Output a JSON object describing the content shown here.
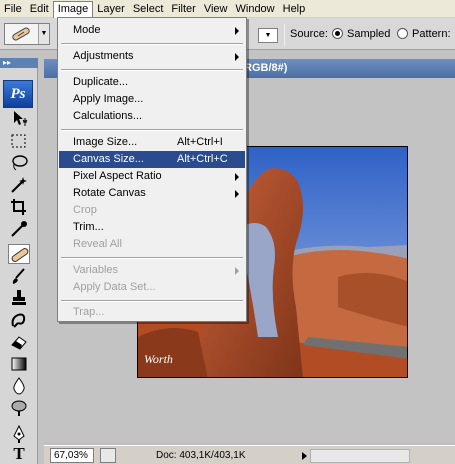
{
  "menubar": {
    "items": [
      {
        "label": "File"
      },
      {
        "label": "Edit"
      },
      {
        "label": "Image"
      },
      {
        "label": "Layer"
      },
      {
        "label": "Select"
      },
      {
        "label": "Filter"
      },
      {
        "label": "View"
      },
      {
        "label": "Window"
      },
      {
        "label": "Help"
      }
    ],
    "active": "Image"
  },
  "options": {
    "source_label": "Source:",
    "sampled_label": "Sampled",
    "pattern_label": "Pattern:",
    "selected_source": "Sampled"
  },
  "toolbox": {
    "logo": "Ps",
    "tools": [
      {
        "icon": "move-tool-icon"
      },
      {
        "icon": "marquee-tool-icon"
      },
      {
        "icon": "lasso-tool-icon"
      },
      {
        "icon": "magic-wand-tool-icon"
      },
      {
        "icon": "crop-tool-icon"
      },
      {
        "icon": "eyedropper-tool-icon"
      },
      {
        "icon": "healing-brush-tool-icon"
      },
      {
        "icon": "brush-tool-icon"
      },
      {
        "icon": "clone-stamp-tool-icon"
      },
      {
        "icon": "history-brush-tool-icon"
      },
      {
        "icon": "eraser-tool-icon"
      },
      {
        "icon": "gradient-tool-icon"
      },
      {
        "icon": "blur-tool-icon"
      },
      {
        "icon": "dodge-tool-icon"
      },
      {
        "icon": "pen-tool-icon"
      },
      {
        "icon": "type-tool-icon"
      }
    ],
    "type_glyph": "T"
  },
  "document": {
    "title_fragment": "RGB/8#)",
    "zoom": "67,03%",
    "doc_info": "Doc: 403,1K/403,1K"
  },
  "image_menu": {
    "items": [
      {
        "label": "Mode",
        "shortcut": "",
        "submenu": true,
        "enabled": true
      },
      {
        "label": "Adjustments",
        "shortcut": "",
        "submenu": true,
        "enabled": true
      },
      {
        "label": "Duplicate...",
        "shortcut": "",
        "submenu": false,
        "enabled": true
      },
      {
        "label": "Apply Image...",
        "shortcut": "",
        "submenu": false,
        "enabled": true
      },
      {
        "label": "Calculations...",
        "shortcut": "",
        "submenu": false,
        "enabled": true
      },
      {
        "label": "Image Size...",
        "shortcut": "Alt+Ctrl+I",
        "submenu": false,
        "enabled": true
      },
      {
        "label": "Canvas Size...",
        "shortcut": "Alt+Ctrl+C",
        "submenu": false,
        "enabled": true,
        "highlighted": true
      },
      {
        "label": "Pixel Aspect Ratio",
        "shortcut": "",
        "submenu": true,
        "enabled": true
      },
      {
        "label": "Rotate Canvas",
        "shortcut": "",
        "submenu": true,
        "enabled": true
      },
      {
        "label": "Crop",
        "shortcut": "",
        "submenu": false,
        "enabled": false
      },
      {
        "label": "Trim...",
        "shortcut": "",
        "submenu": false,
        "enabled": true
      },
      {
        "label": "Reveal All",
        "shortcut": "",
        "submenu": false,
        "enabled": false
      },
      {
        "label": "Variables",
        "shortcut": "",
        "submenu": true,
        "enabled": false
      },
      {
        "label": "Apply Data Set...",
        "shortcut": "",
        "submenu": false,
        "enabled": false
      },
      {
        "label": "Trap...",
        "shortcut": "",
        "submenu": false,
        "enabled": false
      }
    ]
  },
  "photo": {
    "signature": "Worth"
  },
  "colors": {
    "title_bar": "#4c6ea5",
    "menu_highlight": "#2a4b8d",
    "ps_logo": "#1f5bbf"
  }
}
